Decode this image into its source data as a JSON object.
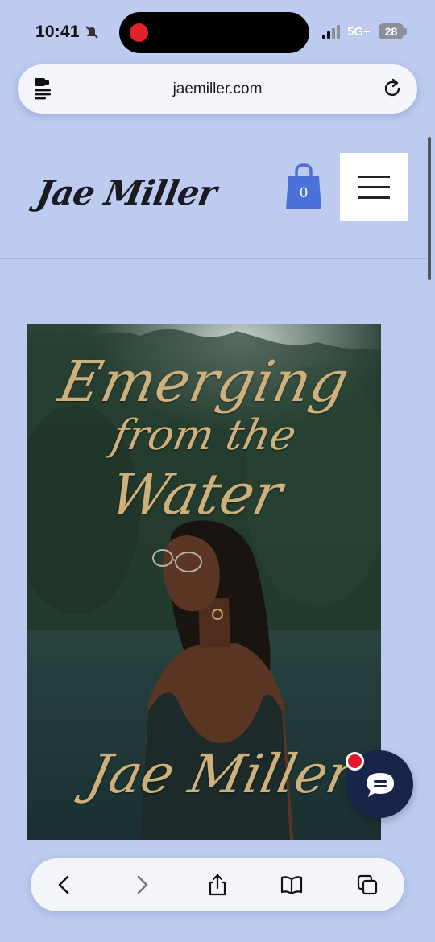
{
  "status_bar": {
    "time": "10:41",
    "network": "5G+",
    "battery": "28",
    "icons": [
      "do-not-disturb-icon",
      "recording-dot",
      "signal-icon",
      "battery-icon"
    ]
  },
  "browser": {
    "url": "jaemiller.com",
    "left_icon": "page-settings-icon",
    "right_icon": "reload-icon",
    "toolbar": [
      "back-icon",
      "forward-icon",
      "share-icon",
      "bookmarks-icon",
      "tabs-icon"
    ]
  },
  "site": {
    "logo_text": "Jae Miller",
    "cart_count": "0",
    "menu_icon": "hamburger-menu-icon",
    "accent_color": "#4a72d8"
  },
  "book": {
    "title_line1": "Emerging",
    "title_line2": "from the",
    "title_line3": "Water",
    "author": "Jae Miller",
    "title_color": "#cdb07b"
  },
  "chat": {
    "icon": "chat-bubble-icon",
    "badge_color": "#e2162c"
  }
}
